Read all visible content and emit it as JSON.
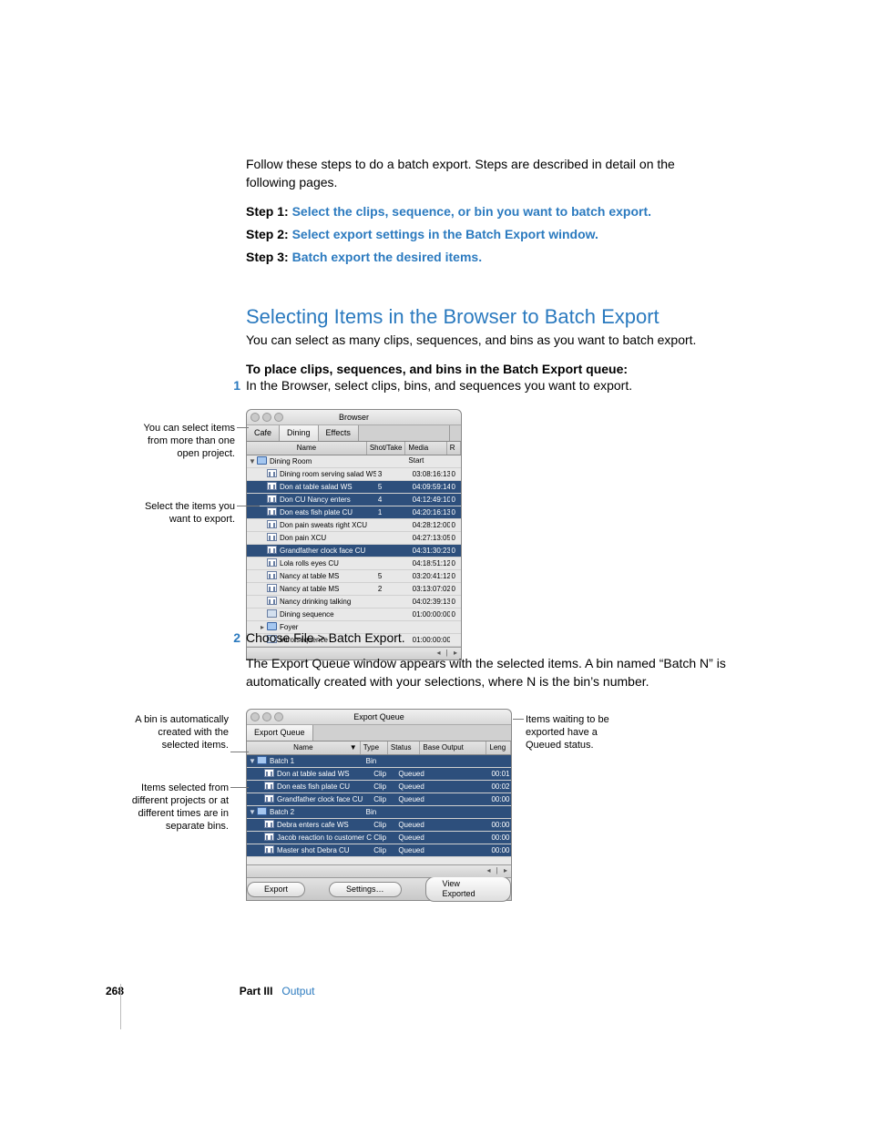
{
  "intro": "Follow these steps to do a batch export. Steps are described in detail on the following pages.",
  "steps": {
    "s1b": "Step 1:",
    "s1l": "Select the clips, sequence, or bin you want to batch export.",
    "s2b": "Step 2:",
    "s2l": "Select export settings in the Batch Export window.",
    "s3b": "Step 3:",
    "s3l": "Batch export the desired items."
  },
  "h2": "Selecting Items in the Browser to Batch Export",
  "h2_desc": "You can select as many clips, sequences, and bins as you want to batch export.",
  "queue_heading": "To place clips, sequences, and bins in the Batch Export queue:",
  "list1_num": "1",
  "list1": "In the Browser, select clips, bins, and sequences you want to export.",
  "caption_a": "You can select items from more than one open project.",
  "caption_b": "Select the items you want to export.",
  "browser": {
    "title": "Browser",
    "tabs": [
      "Cafe",
      "Dining",
      "Effects"
    ],
    "cols": {
      "name": "Name",
      "shot": "Shot/Take",
      "media": "Media Start",
      "r": "R"
    },
    "folder": "Dining Room",
    "rows": [
      {
        "name": "Dining room serving salad WS",
        "shot": "3",
        "media": "03:08:16:13",
        "r": "0",
        "sel": false,
        "t": "clip"
      },
      {
        "name": "Don at table salad WS",
        "shot": "5",
        "media": "04:09:59:14",
        "r": "0",
        "sel": true,
        "t": "clip"
      },
      {
        "name": "Don CU Nancy enters",
        "shot": "4",
        "media": "04:12:49:10",
        "r": "0",
        "sel": true,
        "t": "clip"
      },
      {
        "name": "Don eats fish plate CU",
        "shot": "1",
        "media": "04:20:16:13",
        "r": "0",
        "sel": true,
        "t": "clip"
      },
      {
        "name": "Don pain sweats right XCU",
        "shot": "",
        "media": "04:28:12:00",
        "r": "0",
        "sel": false,
        "t": "clip"
      },
      {
        "name": "Don pain XCU",
        "shot": "",
        "media": "04:27:13:05",
        "r": "0",
        "sel": false,
        "t": "clip"
      },
      {
        "name": "Grandfather clock face CU",
        "shot": "",
        "media": "04:31:30:23",
        "r": "0",
        "sel": true,
        "t": "clip"
      },
      {
        "name": "Lola rolls eyes CU",
        "shot": "",
        "media": "04:18:51:12",
        "r": "0",
        "sel": false,
        "t": "clip"
      },
      {
        "name": "Nancy at table MS",
        "shot": "5",
        "media": "03:20:41:12",
        "r": "0",
        "sel": false,
        "t": "clip"
      },
      {
        "name": "Nancy at table MS",
        "shot": "2",
        "media": "03:13:07:02",
        "r": "0",
        "sel": false,
        "t": "clip"
      },
      {
        "name": "Nancy drinking talking",
        "shot": "",
        "media": "04:02:39:13",
        "r": "0",
        "sel": false,
        "t": "clip"
      },
      {
        "name": "Dining sequence",
        "shot": "",
        "media": "01:00:00:00",
        "r": "0",
        "sel": false,
        "t": "seq"
      },
      {
        "name": "Foyer",
        "shot": "",
        "media": "",
        "r": "",
        "sel": false,
        "t": "bin"
      },
      {
        "name": "Intro sequence",
        "shot": "",
        "media": "01:00:00:00",
        "r": "",
        "sel": false,
        "t": "seq"
      }
    ]
  },
  "list2_num": "2",
  "list2": "Choose File > Batch Export.",
  "list2_para": "The Export Queue window appears with the selected items. A bin named “Batch N” is automatically created with your selections, where N is the bin’s number.",
  "caption_c": "A bin is automatically created with the selected items.",
  "caption_d": "Items selected from different projects or at different times are in separate bins.",
  "caption_e": "Items waiting to be exported have a Queued status.",
  "queue": {
    "title": "Export Queue",
    "tab": "Export Queue",
    "cols": {
      "name": "Name",
      "sort": "▼",
      "type": "Type",
      "status": "Status",
      "base": "Base Output Filename",
      "len": "Leng"
    },
    "bins": [
      {
        "name": "Batch 1",
        "type": "Bin",
        "rows": [
          {
            "name": "Don at table salad WS",
            "type": "Clip",
            "status": "Queued",
            "len": "00:01"
          },
          {
            "name": "Don eats fish plate CU",
            "type": "Clip",
            "status": "Queued",
            "len": "00:02"
          },
          {
            "name": "Grandfather clock face CU",
            "type": "Clip",
            "status": "Queued",
            "len": "00:00"
          }
        ]
      },
      {
        "name": "Batch 2",
        "type": "Bin",
        "rows": [
          {
            "name": "Debra enters cafe WS",
            "type": "Clip",
            "status": "Queued",
            "len": "00:00"
          },
          {
            "name": "Jacob reaction to customer CU",
            "type": "Clip",
            "status": "Queued",
            "len": "00:00"
          },
          {
            "name": "Master shot Debra CU",
            "type": "Clip",
            "status": "Queued",
            "len": "00:00"
          }
        ]
      }
    ],
    "buttons": {
      "export": "Export",
      "settings": "Settings…",
      "view": "View Exported"
    }
  },
  "footer": {
    "page": "268",
    "part": "Part III",
    "section": "Output"
  }
}
